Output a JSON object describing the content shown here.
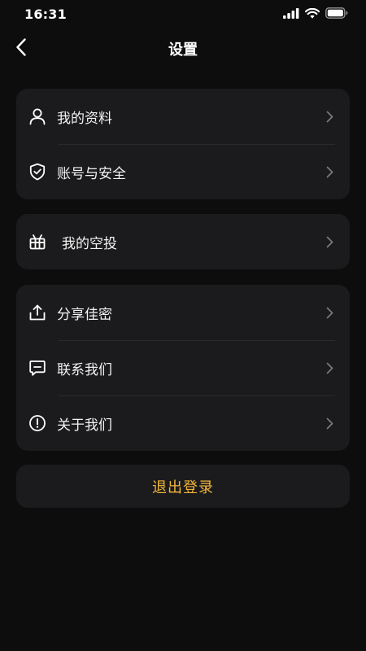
{
  "status_bar": {
    "time": "16:31",
    "icons": [
      "signal-icon",
      "wifi-icon",
      "battery-icon"
    ]
  },
  "header": {
    "back_icon": "chevron-left-icon",
    "title": "设置"
  },
  "groups": [
    {
      "items": [
        {
          "label": "我的资料",
          "icon": "user-icon"
        },
        {
          "label": "账号与安全",
          "icon": "shield-icon"
        }
      ]
    },
    {
      "items": [
        {
          "label": "我的空投",
          "icon": "gift-icon"
        }
      ]
    },
    {
      "items": [
        {
          "label": "分享佳密",
          "icon": "share-icon"
        },
        {
          "label": "联系我们",
          "icon": "message-icon"
        },
        {
          "label": "关于我们",
          "icon": "info-icon"
        }
      ]
    }
  ],
  "logout": {
    "label": "退出登录",
    "color": "#f2b53a"
  },
  "colors": {
    "background": "#0d0d0e",
    "card": "#1b1b1d",
    "chevron": "#7a7a80",
    "accent": "#f2b53a"
  }
}
